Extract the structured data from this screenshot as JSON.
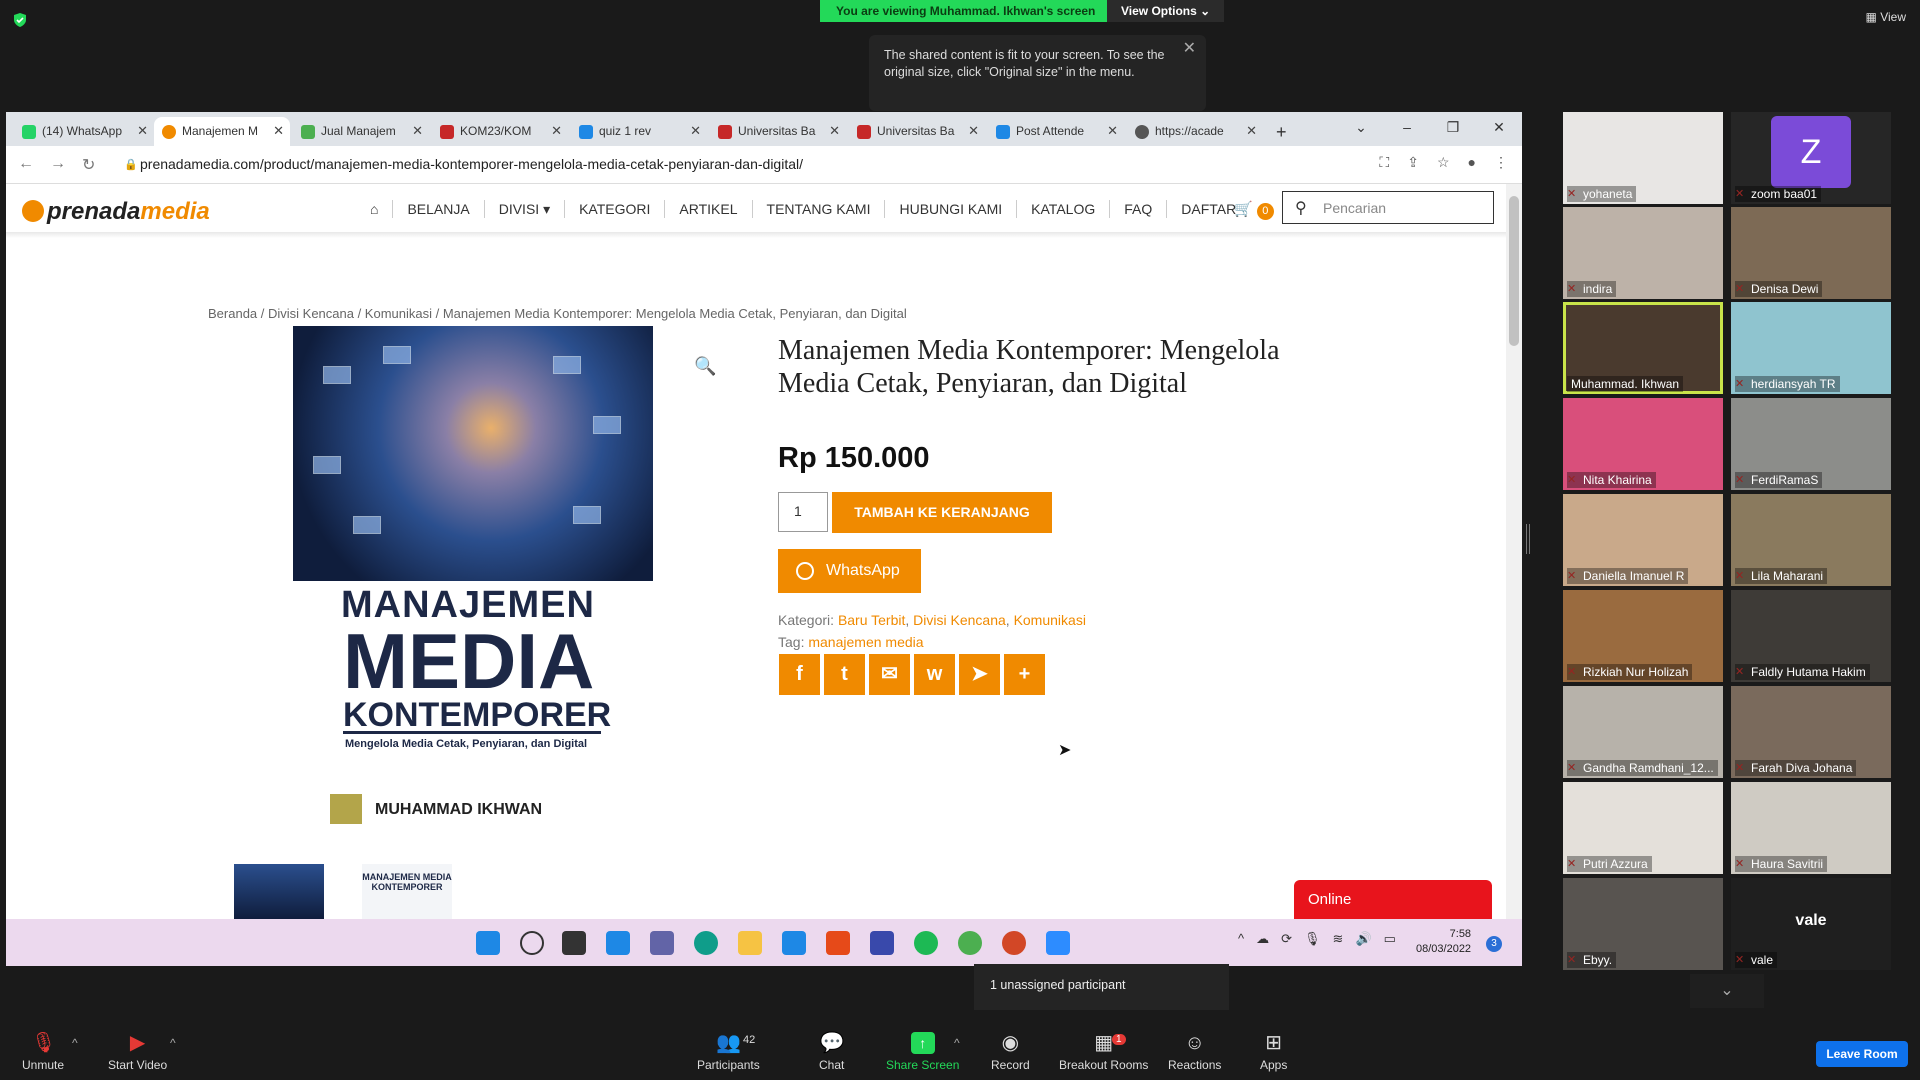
{
  "zoom": {
    "banner": "You are viewing Muhammad. Ikhwan's screen",
    "view_options": "View Options ⌄",
    "view_label": "View",
    "tooltip": "The shared content is fit to your screen. To see the original size, click \"Original size\" in the menu.",
    "unassigned": "1 unassigned participant",
    "toolbar": {
      "unmute": "Unmute",
      "start_video": "Start Video",
      "participants": "Participants",
      "participants_count": "42",
      "chat": "Chat",
      "share_screen": "Share Screen",
      "record": "Record",
      "breakout_rooms": "Breakout Rooms",
      "breakout_badge": "1",
      "reactions": "Reactions",
      "apps": "Apps",
      "leave_room": "Leave Room"
    },
    "participants": [
      {
        "name": "yohaneta"
      },
      {
        "name": "zoom baa01",
        "initial": "Z"
      },
      {
        "name": "indira"
      },
      {
        "name": "Denisa Dewi"
      },
      {
        "name": "Muhammad. Ikhwan"
      },
      {
        "name": "herdiansyah TR"
      },
      {
        "name": "Nita Khairina"
      },
      {
        "name": "FerdiRamaS"
      },
      {
        "name": "Daniella Imanuel R"
      },
      {
        "name": "Lila Maharani"
      },
      {
        "name": "Rizkiah Nur Holizah"
      },
      {
        "name": "Faldly Hutama Hakim"
      },
      {
        "name": "Gandha Ramdhani_12..."
      },
      {
        "name": "Farah Diva Johana"
      },
      {
        "name": "Putri Azzura"
      },
      {
        "name": "Haura Savitrii"
      },
      {
        "name": "Ebyy."
      },
      {
        "name": "vale",
        "center": "vale"
      }
    ],
    "colors": {
      "green": "#23d959",
      "zoom_blue": "#0e71eb",
      "speaking": "#c9e44a"
    }
  },
  "browser": {
    "tabs": [
      {
        "label": "(14) WhatsApp",
        "icon_color": "#25d366"
      },
      {
        "label": "Manajemen M",
        "icon_color": "#f08a00"
      },
      {
        "label": "Jual Manajem",
        "icon_color": "#4caf50"
      },
      {
        "label": "KOM23/KOM",
        "icon_color": "#c62828"
      },
      {
        "label": "quiz 1 rev",
        "icon_color": "#1e88e5"
      },
      {
        "label": "Universitas Ba",
        "icon_color": "#c62828"
      },
      {
        "label": "Universitas Ba",
        "icon_color": "#c62828"
      },
      {
        "label": "Post Attende",
        "icon_color": "#1e88e5"
      },
      {
        "label": "https://acade",
        "icon_color": "#555555"
      }
    ],
    "new_tab": "+",
    "url": "prenadamedia.com/product/manajemen-media-kontemporer-mengelola-media-cetak-penyiaran-dan-digital/"
  },
  "site": {
    "logo_a": "prenada",
    "logo_b": "media",
    "nav": [
      "BELANJA",
      "DIVISI ▾",
      "KATEGORI",
      "ARTIKEL",
      "TENTANG KAMI",
      "HUBUNGI KAMI",
      "KATALOG",
      "FAQ",
      "DAFTAR"
    ],
    "cart_count": "0",
    "search_placeholder": "Pencarian",
    "breadcrumb": "Beranda / Divisi Kencana / Komunikasi / Manajemen Media Kontemporer: Mengelola Media Cetak, Penyiaran, dan Digital",
    "cover": {
      "line1": "MANAJEMEN",
      "line2": "MEDIA",
      "line3": "KONTEMPORER",
      "subtitle": "Mengelola Media Cetak, Penyiaran, dan Digital",
      "author": "MUHAMMAD IKHWAN"
    },
    "thumb2_text": "MANAJEMEN MEDIA KONTEMPORER",
    "product_title": "Manajemen Media Kontemporer: Mengelola Media Cetak, Penyiaran, dan Digital",
    "price": "Rp 150.000",
    "qty": "1",
    "add_to_cart": "TAMBAH KE KERANJANG",
    "whatsapp": "WhatsApp",
    "kategori_label": "Kategori:",
    "kategori": [
      "Baru Terbit",
      "Divisi Kencana",
      "Komunikasi"
    ],
    "tag_label": "Tag:",
    "tag": "manajemen media",
    "share": [
      "f",
      "t",
      "✉",
      "w",
      "➤",
      "+"
    ],
    "online": "Online",
    "accent": "#f08a00"
  },
  "taskbar": {
    "time": "7:58",
    "date": "08/03/2022",
    "notif": "3"
  }
}
